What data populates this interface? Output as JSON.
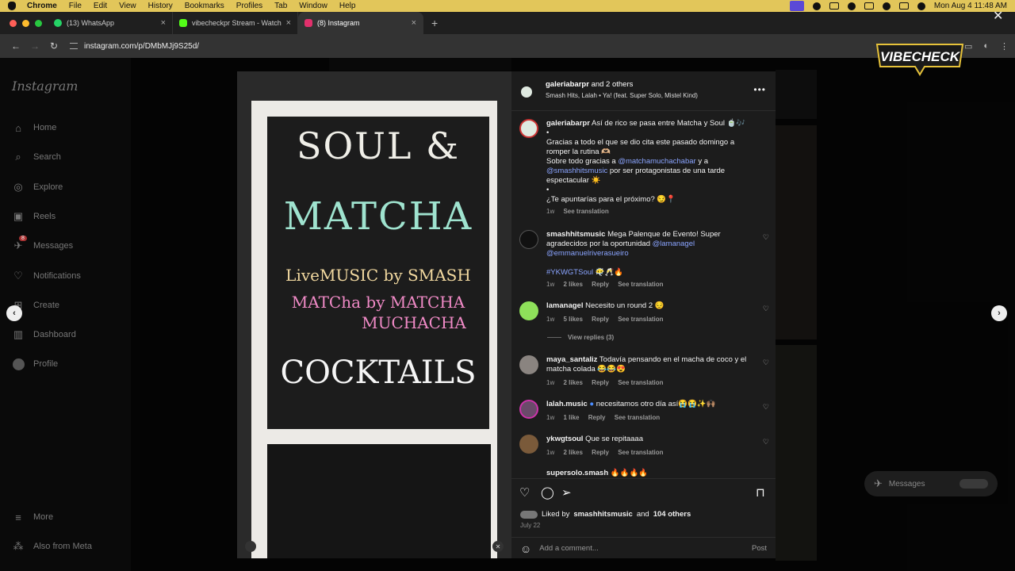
{
  "menubar": {
    "app": "Chrome",
    "items": [
      "File",
      "Edit",
      "View",
      "History",
      "Bookmarks",
      "Profiles",
      "Tab",
      "Window",
      "Help"
    ],
    "clock": "Mon Aug 4  11:48 AM"
  },
  "tabs": [
    {
      "title": "(13) WhatsApp",
      "color": "#25d366"
    },
    {
      "title": "vibecheckpr Stream - Watch",
      "color": "#53fc18"
    },
    {
      "title": "(8) Instagram",
      "color": "#e1306c"
    }
  ],
  "address": {
    "url": "instagram.com/p/DMbMJj9S25d/"
  },
  "sidebar": {
    "logo": "Instagram",
    "items": [
      {
        "label": "Home",
        "icon": "home-icon"
      },
      {
        "label": "Search",
        "icon": "search-icon"
      },
      {
        "label": "Explore",
        "icon": "compass-icon"
      },
      {
        "label": "Reels",
        "icon": "reels-icon"
      },
      {
        "label": "Messages",
        "icon": "messenger-icon",
        "badge": "8"
      },
      {
        "label": "Notifications",
        "icon": "heart-icon"
      },
      {
        "label": "Create",
        "icon": "plus-square-icon"
      },
      {
        "label": "Dashboard",
        "icon": "chart-icon"
      },
      {
        "label": "Profile",
        "icon": "profile-avatar"
      }
    ],
    "more": "More",
    "also": "Also from Meta"
  },
  "post": {
    "author": "galeriabarpr",
    "and_others": "and 2 others",
    "audio": "Smash Hits, Lalah • Ya! (feat. Super Solo, Mistel Kind)",
    "media": {
      "line1": "SOUL &",
      "line2": "MATCHA",
      "line3": "LiveMUSIC by SMASH",
      "line4": "MATCha by MATCHA",
      "line5": "MUCHACHA",
      "line6": "COCKTAILS"
    },
    "caption": {
      "user": "galeriabarpr",
      "l1": "Así de rico se pasa entre Matcha y Soul 🍵🎶",
      "l2": "•",
      "l3": "Gracias a todo el que se dio cita este pasado domingo a romper la rutina 🫶🏼",
      "l4a": "Sobre todo gracias a",
      "m1": "@matchamuchachabar",
      "l4b": "y a",
      "m2": "@smashhitsmusic",
      "l4c": "por ser protagonistas de una tarde espectacular ☀️",
      "l5": "•",
      "l6": "¿Te apuntarías para el próximo? 😏📍",
      "time": "1w",
      "translate": "See translation"
    },
    "comments": [
      {
        "user": "smashhitsmusic",
        "text": "Mega Palenque de Evento! Super agradecidos por la oportunidad",
        "m1": "@lamanagel",
        "m2": "@emmanuelriverasueiro",
        "tag": "#YKWGTSoul 😶‍🌫️🥂🔥",
        "time": "1w",
        "likes": "2 likes",
        "reply": "Reply",
        "translate": "See translation"
      },
      {
        "user": "lamanagel",
        "text": "Necesito un round 2 😔",
        "time": "1w",
        "likes": "5 likes",
        "reply": "Reply",
        "translate": "See translation",
        "replies": "View replies (3)"
      },
      {
        "user": "maya_santaliz",
        "text": "Todavía pensando en el macha de coco y el matcha colada 😂😂😍",
        "time": "1w",
        "likes": "2 likes",
        "reply": "Reply",
        "translate": "See translation"
      },
      {
        "user": "lalah.music",
        "text": "necesitamos otro día así😭😭✨🙌🏽",
        "time": "1w",
        "likes": "1 like",
        "reply": "Reply",
        "translate": "See translation"
      },
      {
        "user": "ykwgtsoul",
        "text": "Que se repitaaaa",
        "time": "1w",
        "likes": "2 likes",
        "reply": "Reply",
        "translate": "See translation"
      },
      {
        "user": "supersolo.smash",
        "text": "🔥🔥🔥🔥"
      }
    ],
    "liked_prefix": "Liked by",
    "liked_user": "smashhitsmusic",
    "liked_and": "and",
    "liked_others": "104 others",
    "date": "July 22",
    "add_comment": "Add a comment...",
    "post_btn": "Post"
  },
  "messages_pill": "Messages",
  "watermark": "VIBECHECK",
  "colors": {
    "accent_link": "#8aa4ff",
    "menubar": "#e2c65a"
  }
}
